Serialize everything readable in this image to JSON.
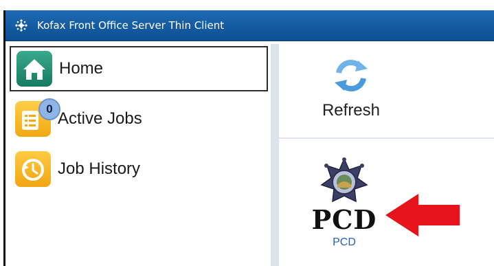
{
  "window": {
    "title": "Kofax Front Office Server Thin Client"
  },
  "sidebar": {
    "items": [
      {
        "label": "Home",
        "icon": "home-icon",
        "active": true
      },
      {
        "label": "Active Jobs",
        "icon": "jobs-list-icon",
        "badge": "0"
      },
      {
        "label": "Job History",
        "icon": "history-icon"
      }
    ]
  },
  "toolbar": {
    "refresh_label": "Refresh"
  },
  "shortcut": {
    "logo_text": "PCD",
    "label": "PCD"
  },
  "colors": {
    "titlebar": "#1a62ab",
    "arrow": "#e8141b",
    "link": "#2a5fb0"
  }
}
